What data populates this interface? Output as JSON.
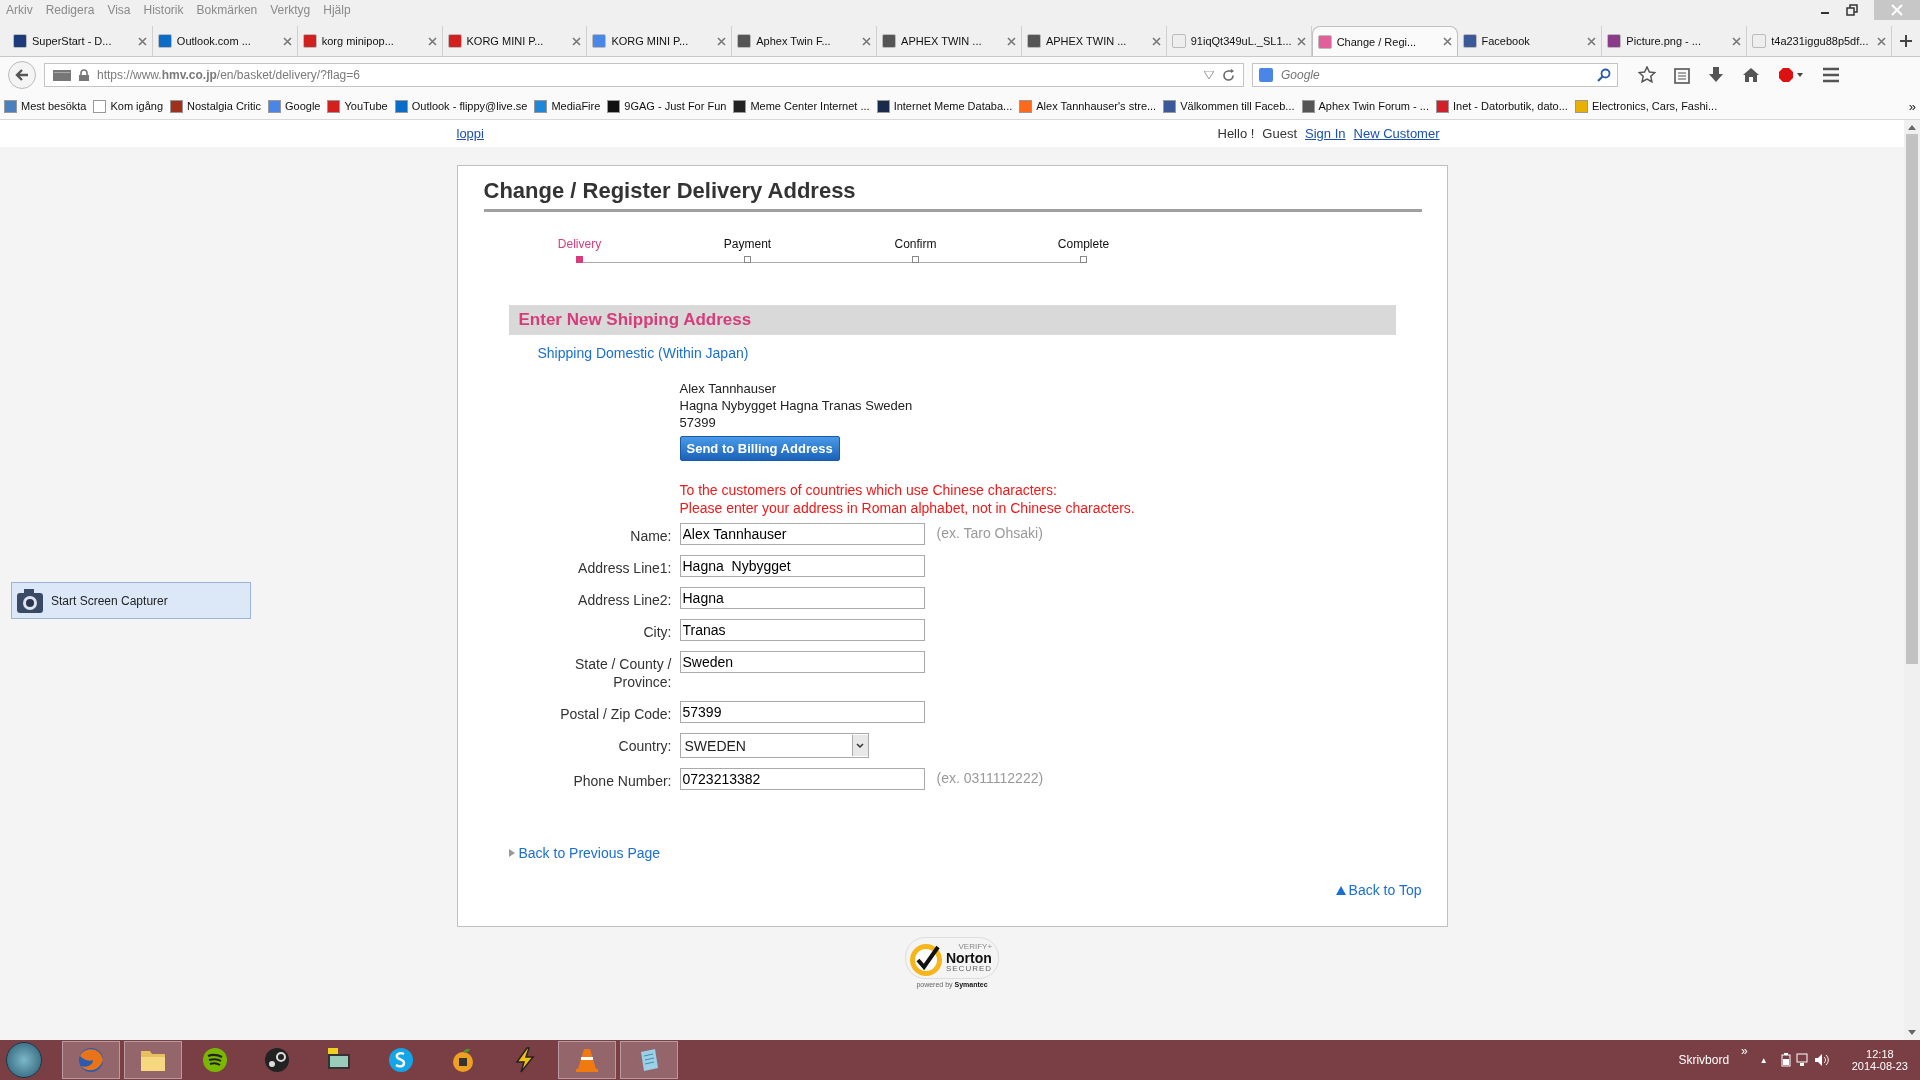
{
  "menu_bar": [
    "Arkiv",
    "Redigera",
    "Visa",
    "Historik",
    "Bokmärken",
    "Verktyg",
    "Hjälp"
  ],
  "tabs": [
    {
      "title": "SuperStart - D...",
      "color": "#1d3a7a",
      "selected": false
    },
    {
      "title": "Outlook.com ...",
      "color": "#0a6cc8",
      "selected": false
    },
    {
      "title": "korg minipop...",
      "color": "#d41f1f",
      "selected": false
    },
    {
      "title": "KORG MINI P...",
      "color": "#d41f1f",
      "selected": false
    },
    {
      "title": "KORG MINI P...",
      "color": "#4a86e8",
      "selected": false
    },
    {
      "title": "Aphex Twin F...",
      "color": "#555555",
      "selected": false
    },
    {
      "title": "APHEX TWIN ...",
      "color": "#555555",
      "selected": false
    },
    {
      "title": "APHEX TWIN ...",
      "color": "#555555",
      "selected": false
    },
    {
      "title": "91iqQt349uL._SL1...",
      "color": "#eeeeee",
      "selected": false
    },
    {
      "title": "Change / Regi...",
      "color": "#e0609a",
      "selected": true
    },
    {
      "title": "Facebook",
      "color": "#3b5998",
      "selected": false
    },
    {
      "title": "Picture.png - ...",
      "color": "#8a3c8a",
      "selected": false
    },
    {
      "title": "t4a231iggu88p5df...",
      "color": "#eeeeee",
      "selected": false
    }
  ],
  "address_bar": {
    "url": "https://www.**hmv.co.jp**/en/basket/delivery/?flag=6"
  },
  "search_box": {
    "placeholder": "Google"
  },
  "bookmarks": [
    {
      "label": "Mest besökta",
      "color": "#4a7fc0"
    },
    {
      "label": "Kom igång",
      "color": "#ffffff"
    },
    {
      "label": "Nostalgia Critic",
      "color": "#a0301c"
    },
    {
      "label": "Google",
      "color": "#4a86e8"
    },
    {
      "label": "YouTube",
      "color": "#d41f1f"
    },
    {
      "label": "Outlook - flippy@live.se",
      "color": "#0a6cc8"
    },
    {
      "label": "MediaFire",
      "color": "#1e88d8"
    },
    {
      "label": "9GAG - Just For Fun",
      "color": "#111111"
    },
    {
      "label": "Meme Center Internet ...",
      "color": "#222222"
    },
    {
      "label": "Internet Meme Databa...",
      "color": "#1a2a4a"
    },
    {
      "label": "Alex Tannhauser's stre...",
      "color": "#ff6a1a"
    },
    {
      "label": "Välkommen till Faceb...",
      "color": "#3b5998"
    },
    {
      "label": "Aphex Twin Forum - ...",
      "color": "#555555"
    },
    {
      "label": "Inet - Datorbutik, dato...",
      "color": "#d41f2a"
    },
    {
      "label": "Electronics, Cars, Fashi...",
      "color": "#e8b000"
    }
  ],
  "bookmarks_overflow": "»",
  "header": {
    "home_link": "loppi",
    "greeting": "Hello !",
    "user": "Guest",
    "sign_in": "Sign In",
    "new_customer": "New Customer"
  },
  "page_title": "Change / Register Delivery Address",
  "steps": [
    {
      "label": "Delivery",
      "selected": true
    },
    {
      "label": "Payment",
      "selected": false
    },
    {
      "label": "Confirm",
      "selected": false
    },
    {
      "label": "Complete",
      "selected": false
    }
  ],
  "section_title": "Enter New Shipping Address",
  "shipping_link": "Shipping Domestic (Within Japan)",
  "saved_address": [
    "Alex Tannhauser",
    "Hagna Nybygget Hagna Tranas Sweden",
    "57399"
  ],
  "billing_button": "Send to Billing Address",
  "notice": [
    "To the customers of countries which use Chinese characters:",
    "Please enter your address in Roman alphabet, not in Chinese characters."
  ],
  "fields": [
    {
      "label": "Name:",
      "value": "Alex Tannhauser",
      "hint": "(ex. Taro Ohsaki)",
      "kind": "text"
    },
    {
      "label": "Address Line1:",
      "value": "Hagna  Nybygget",
      "kind": "text"
    },
    {
      "label": "Address Line2:",
      "value": "Hagna",
      "kind": "text"
    },
    {
      "label": "City:",
      "value": "Tranas",
      "kind": "text"
    },
    {
      "label": "State / County / Province:",
      "value": "Sweden",
      "kind": "text"
    },
    {
      "label": "Postal / Zip Code:",
      "value": "57399",
      "kind": "text"
    },
    {
      "label": "Country:",
      "value": "SWEDEN",
      "kind": "select"
    },
    {
      "label": "Phone Number:",
      "value": "0723213382",
      "hint": "(ex. 0311112222)",
      "kind": "text"
    }
  ],
  "back_link": "Back to Previous Page",
  "top_link": "Back to Top",
  "seal": {
    "verify": "VERIFY+",
    "brand": "Norton",
    "secured": "SECURED",
    "powered": "powered by",
    "company": "Symantec"
  },
  "capturer_button": "Start Screen Capturer",
  "taskbar": {
    "apps": [
      {
        "kind": "browser",
        "active": true
      },
      {
        "kind": "folder",
        "active": true
      },
      {
        "kind": "music",
        "active": false
      },
      {
        "kind": "game",
        "active": false
      },
      {
        "kind": "monitor",
        "active": false
      },
      {
        "kind": "chat",
        "active": false
      },
      {
        "kind": "fruit",
        "active": false
      },
      {
        "kind": "bolt",
        "active": false
      },
      {
        "kind": "cone",
        "active": true
      },
      {
        "kind": "note",
        "active": true
      }
    ],
    "desktop_label": "Skrivbord",
    "overflow": "»",
    "tray_arrow": "▲",
    "time": "12:18",
    "date": "2014-08-23"
  }
}
